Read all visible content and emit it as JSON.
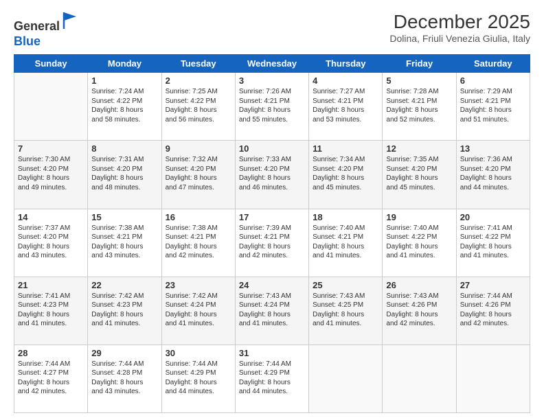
{
  "logo": {
    "line1": "General",
    "line2": "Blue"
  },
  "header": {
    "title": "December 2025",
    "subtitle": "Dolina, Friuli Venezia Giulia, Italy"
  },
  "days_of_week": [
    "Sunday",
    "Monday",
    "Tuesday",
    "Wednesday",
    "Thursday",
    "Friday",
    "Saturday"
  ],
  "weeks": [
    [
      {
        "day": "",
        "info": ""
      },
      {
        "day": "1",
        "info": "Sunrise: 7:24 AM\nSunset: 4:22 PM\nDaylight: 8 hours\nand 58 minutes."
      },
      {
        "day": "2",
        "info": "Sunrise: 7:25 AM\nSunset: 4:22 PM\nDaylight: 8 hours\nand 56 minutes."
      },
      {
        "day": "3",
        "info": "Sunrise: 7:26 AM\nSunset: 4:21 PM\nDaylight: 8 hours\nand 55 minutes."
      },
      {
        "day": "4",
        "info": "Sunrise: 7:27 AM\nSunset: 4:21 PM\nDaylight: 8 hours\nand 53 minutes."
      },
      {
        "day": "5",
        "info": "Sunrise: 7:28 AM\nSunset: 4:21 PM\nDaylight: 8 hours\nand 52 minutes."
      },
      {
        "day": "6",
        "info": "Sunrise: 7:29 AM\nSunset: 4:21 PM\nDaylight: 8 hours\nand 51 minutes."
      }
    ],
    [
      {
        "day": "7",
        "info": "Sunrise: 7:30 AM\nSunset: 4:20 PM\nDaylight: 8 hours\nand 49 minutes."
      },
      {
        "day": "8",
        "info": "Sunrise: 7:31 AM\nSunset: 4:20 PM\nDaylight: 8 hours\nand 48 minutes."
      },
      {
        "day": "9",
        "info": "Sunrise: 7:32 AM\nSunset: 4:20 PM\nDaylight: 8 hours\nand 47 minutes."
      },
      {
        "day": "10",
        "info": "Sunrise: 7:33 AM\nSunset: 4:20 PM\nDaylight: 8 hours\nand 46 minutes."
      },
      {
        "day": "11",
        "info": "Sunrise: 7:34 AM\nSunset: 4:20 PM\nDaylight: 8 hours\nand 45 minutes."
      },
      {
        "day": "12",
        "info": "Sunrise: 7:35 AM\nSunset: 4:20 PM\nDaylight: 8 hours\nand 45 minutes."
      },
      {
        "day": "13",
        "info": "Sunrise: 7:36 AM\nSunset: 4:20 PM\nDaylight: 8 hours\nand 44 minutes."
      }
    ],
    [
      {
        "day": "14",
        "info": "Sunrise: 7:37 AM\nSunset: 4:20 PM\nDaylight: 8 hours\nand 43 minutes."
      },
      {
        "day": "15",
        "info": "Sunrise: 7:38 AM\nSunset: 4:21 PM\nDaylight: 8 hours\nand 43 minutes."
      },
      {
        "day": "16",
        "info": "Sunrise: 7:38 AM\nSunset: 4:21 PM\nDaylight: 8 hours\nand 42 minutes."
      },
      {
        "day": "17",
        "info": "Sunrise: 7:39 AM\nSunset: 4:21 PM\nDaylight: 8 hours\nand 42 minutes."
      },
      {
        "day": "18",
        "info": "Sunrise: 7:40 AM\nSunset: 4:21 PM\nDaylight: 8 hours\nand 41 minutes."
      },
      {
        "day": "19",
        "info": "Sunrise: 7:40 AM\nSunset: 4:22 PM\nDaylight: 8 hours\nand 41 minutes."
      },
      {
        "day": "20",
        "info": "Sunrise: 7:41 AM\nSunset: 4:22 PM\nDaylight: 8 hours\nand 41 minutes."
      }
    ],
    [
      {
        "day": "21",
        "info": "Sunrise: 7:41 AM\nSunset: 4:23 PM\nDaylight: 8 hours\nand 41 minutes."
      },
      {
        "day": "22",
        "info": "Sunrise: 7:42 AM\nSunset: 4:23 PM\nDaylight: 8 hours\nand 41 minutes."
      },
      {
        "day": "23",
        "info": "Sunrise: 7:42 AM\nSunset: 4:24 PM\nDaylight: 8 hours\nand 41 minutes."
      },
      {
        "day": "24",
        "info": "Sunrise: 7:43 AM\nSunset: 4:24 PM\nDaylight: 8 hours\nand 41 minutes."
      },
      {
        "day": "25",
        "info": "Sunrise: 7:43 AM\nSunset: 4:25 PM\nDaylight: 8 hours\nand 41 minutes."
      },
      {
        "day": "26",
        "info": "Sunrise: 7:43 AM\nSunset: 4:26 PM\nDaylight: 8 hours\nand 42 minutes."
      },
      {
        "day": "27",
        "info": "Sunrise: 7:44 AM\nSunset: 4:26 PM\nDaylight: 8 hours\nand 42 minutes."
      }
    ],
    [
      {
        "day": "28",
        "info": "Sunrise: 7:44 AM\nSunset: 4:27 PM\nDaylight: 8 hours\nand 42 minutes."
      },
      {
        "day": "29",
        "info": "Sunrise: 7:44 AM\nSunset: 4:28 PM\nDaylight: 8 hours\nand 43 minutes."
      },
      {
        "day": "30",
        "info": "Sunrise: 7:44 AM\nSunset: 4:29 PM\nDaylight: 8 hours\nand 44 minutes."
      },
      {
        "day": "31",
        "info": "Sunrise: 7:44 AM\nSunset: 4:29 PM\nDaylight: 8 hours\nand 44 minutes."
      },
      {
        "day": "",
        "info": ""
      },
      {
        "day": "",
        "info": ""
      },
      {
        "day": "",
        "info": ""
      }
    ]
  ]
}
